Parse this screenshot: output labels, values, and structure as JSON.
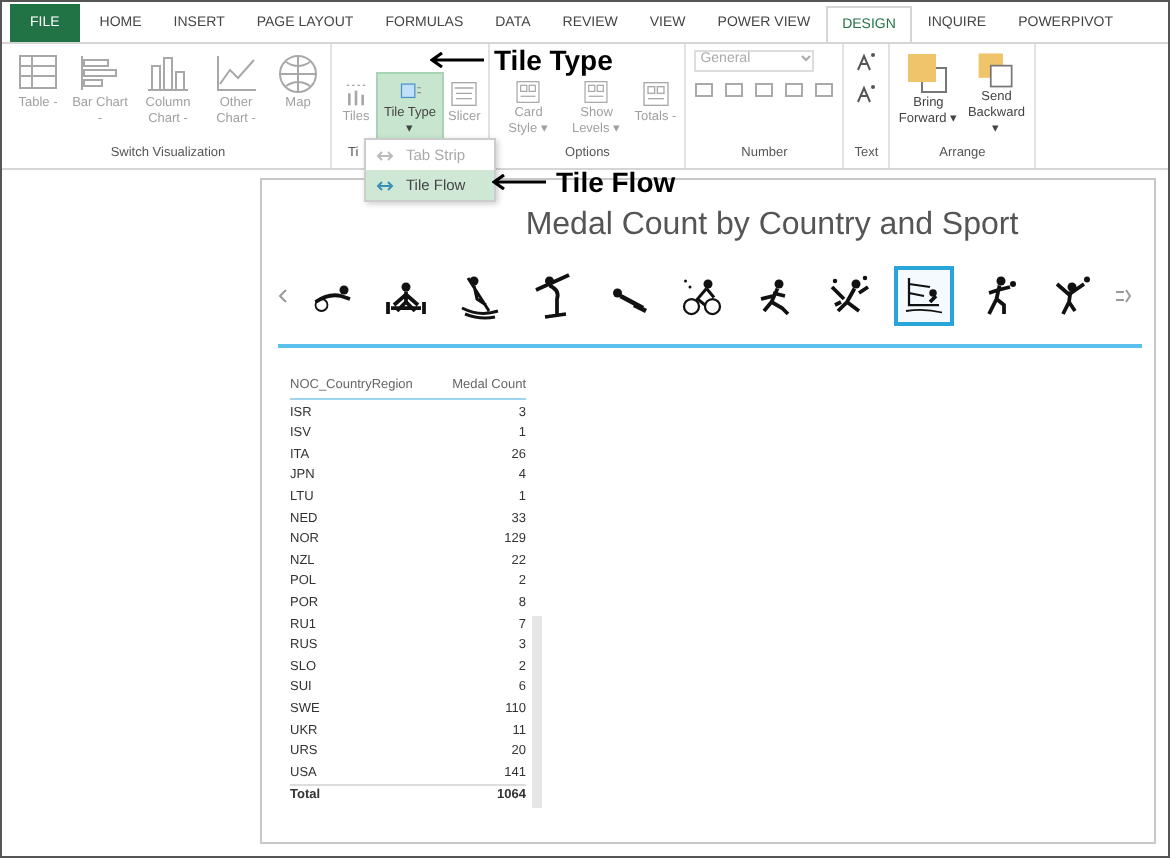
{
  "tabs": [
    {
      "label": "FILE",
      "kind": "file",
      "selected": false
    },
    {
      "label": "HOME",
      "kind": "tab",
      "selected": false
    },
    {
      "label": "INSERT",
      "kind": "tab",
      "selected": false
    },
    {
      "label": "PAGE LAYOUT",
      "kind": "tab",
      "selected": false
    },
    {
      "label": "FORMULAS",
      "kind": "tab",
      "selected": false
    },
    {
      "label": "DATA",
      "kind": "tab",
      "selected": false
    },
    {
      "label": "REVIEW",
      "kind": "tab",
      "selected": false
    },
    {
      "label": "VIEW",
      "kind": "tab",
      "selected": false
    },
    {
      "label": "POWER VIEW",
      "kind": "tab",
      "selected": false
    },
    {
      "label": "DESIGN",
      "kind": "tab",
      "selected": true
    },
    {
      "label": "INQUIRE",
      "kind": "tab",
      "selected": false
    },
    {
      "label": "POWERPIVOT",
      "kind": "tab",
      "selected": false
    }
  ],
  "ribbon_groups": [
    {
      "label": "Switch Visualization",
      "buttons": [
        {
          "label": "Table",
          "caret": "-",
          "disabled": true,
          "pressed": false
        },
        {
          "label": "Bar Chart",
          "caret": "-",
          "disabled": true,
          "pressed": false
        },
        {
          "label": "Column Chart",
          "caret": "-",
          "disabled": true,
          "pressed": false
        },
        {
          "label": "Other Chart",
          "caret": "-",
          "disabled": true,
          "pressed": false
        },
        {
          "label": "Map",
          "disabled": true,
          "pressed": false
        }
      ]
    },
    {
      "label": "Ti",
      "buttons": [
        {
          "label": "Tiles",
          "disabled": true,
          "pressed": false
        },
        {
          "label": "Tile Type",
          "caret": "▾",
          "disabled": false,
          "pressed": true
        },
        {
          "label": "Slicer",
          "disabled": true,
          "pressed": false
        }
      ]
    },
    {
      "label": "Options",
      "buttons": [
        {
          "label": "Card Style",
          "caret": "▾",
          "disabled": true,
          "pressed": false
        },
        {
          "label": "Show Levels",
          "caret": "▾",
          "disabled": true,
          "pressed": false
        },
        {
          "label": "Totals",
          "caret": "-",
          "disabled": true,
          "pressed": false
        }
      ]
    },
    {
      "label": "Number",
      "kind": "number",
      "format": "General"
    },
    {
      "label": "Text",
      "kind": "text"
    },
    {
      "label": "Arrange",
      "buttons": [
        {
          "label": "Bring Forward",
          "caret": "▾",
          "disabled": false,
          "pressed": false
        },
        {
          "label": "Send Backward",
          "caret": "▾",
          "disabled": false,
          "pressed": false
        }
      ]
    }
  ],
  "tile_type_menu": [
    {
      "label": "Tab Strip",
      "disabled": true,
      "selected": false
    },
    {
      "label": "Tile Flow",
      "disabled": false,
      "selected": true
    }
  ],
  "callouts": [
    {
      "label": "Tile Type"
    },
    {
      "label": "Tile Flow"
    }
  ],
  "report": {
    "title": "Medal Count by Country and Sport",
    "tiles": [
      {
        "selected": false
      },
      {
        "selected": false
      },
      {
        "selected": false
      },
      {
        "selected": false
      },
      {
        "selected": false
      },
      {
        "selected": false
      },
      {
        "selected": false
      },
      {
        "selected": false
      },
      {
        "selected": true
      },
      {
        "selected": false
      },
      {
        "selected": false
      }
    ],
    "table": {
      "columns": [
        "NOC_CountryRegion",
        "Medal Count"
      ],
      "rows": [
        [
          "ISR",
          "3"
        ],
        [
          "ISV",
          "1"
        ],
        [
          "ITA",
          "26"
        ],
        [
          "JPN",
          "4"
        ],
        [
          "LTU",
          "1"
        ],
        [
          "NED",
          "33"
        ],
        [
          "NOR",
          "129"
        ],
        [
          "NZL",
          "22"
        ],
        [
          "POL",
          "2"
        ],
        [
          "POR",
          "8"
        ],
        [
          "RU1",
          "7"
        ],
        [
          "RUS",
          "3"
        ],
        [
          "SLO",
          "2"
        ],
        [
          "SUI",
          "6"
        ],
        [
          "SWE",
          "110"
        ],
        [
          "UKR",
          "11"
        ],
        [
          "URS",
          "20"
        ],
        [
          "USA",
          "141"
        ]
      ],
      "total": [
        "Total",
        "1064"
      ]
    }
  }
}
